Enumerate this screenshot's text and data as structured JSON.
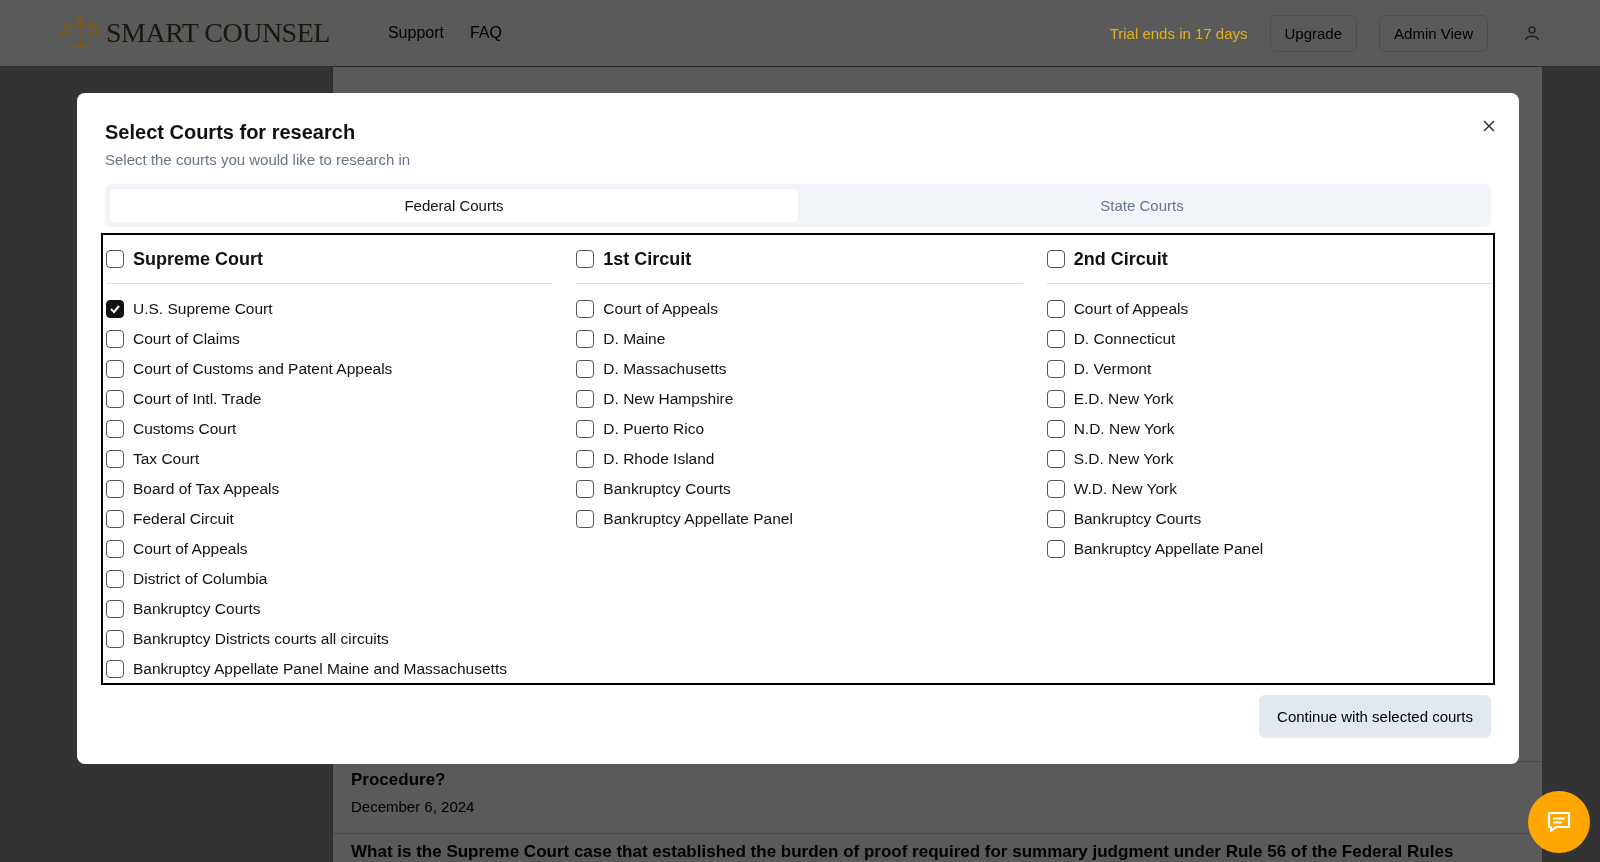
{
  "header": {
    "logo": "SMART COUNSEL",
    "nav": [
      "Support",
      "FAQ"
    ],
    "trial": "Trial ends in 17 days",
    "buttons": [
      "Upgrade",
      "Admin View"
    ]
  },
  "history": [
    {
      "title": "Procedure?",
      "date": "December 6, 2024"
    },
    {
      "title": "What is the Supreme Court case that established the burden of proof required for summary judgment under Rule 56 of the Federal Rules"
    }
  ],
  "dialog": {
    "title": "Select Courts for research",
    "subtitle": "Select the courts you would like to research in",
    "tabs": [
      {
        "label": "Federal Courts",
        "selected": true
      },
      {
        "label": "State Courts",
        "selected": false
      }
    ],
    "groups": [
      {
        "name": "Supreme Court",
        "checked": false,
        "courts": [
          {
            "name": "U.S. Supreme Court",
            "checked": true
          },
          {
            "name": "Court of Claims",
            "checked": false
          },
          {
            "name": "Court of Customs and Patent Appeals",
            "checked": false
          },
          {
            "name": "Court of Intl. Trade",
            "checked": false
          },
          {
            "name": "Customs Court",
            "checked": false
          },
          {
            "name": "Tax Court",
            "checked": false
          },
          {
            "name": "Board of Tax Appeals",
            "checked": false
          },
          {
            "name": "Federal Circuit",
            "checked": false
          },
          {
            "name": "Court of Appeals",
            "checked": false
          },
          {
            "name": "District of Columbia",
            "checked": false
          },
          {
            "name": "Bankruptcy Courts",
            "checked": false
          },
          {
            "name": "Bankruptcy Districts courts all circuits",
            "checked": false
          },
          {
            "name": "Bankruptcy Appellate Panel Maine and Massachusetts",
            "checked": false
          }
        ]
      },
      {
        "name": "1st Circuit",
        "checked": false,
        "courts": [
          {
            "name": "Court of Appeals",
            "checked": false
          },
          {
            "name": "D. Maine",
            "checked": false
          },
          {
            "name": "D. Massachusetts",
            "checked": false
          },
          {
            "name": "D. New Hampshire",
            "checked": false
          },
          {
            "name": "D. Puerto Rico",
            "checked": false
          },
          {
            "name": "D. Rhode Island",
            "checked": false
          },
          {
            "name": "Bankruptcy Courts",
            "checked": false
          },
          {
            "name": "Bankruptcy Appellate Panel",
            "checked": false
          }
        ]
      },
      {
        "name": "2nd Circuit",
        "checked": false,
        "courts": [
          {
            "name": "Court of Appeals",
            "checked": false
          },
          {
            "name": "D. Connecticut",
            "checked": false
          },
          {
            "name": "D. Vermont",
            "checked": false
          },
          {
            "name": "E.D. New York",
            "checked": false
          },
          {
            "name": "N.D. New York",
            "checked": false
          },
          {
            "name": "S.D. New York",
            "checked": false
          },
          {
            "name": "W.D. New York",
            "checked": false
          },
          {
            "name": "Bankruptcy Courts",
            "checked": false
          },
          {
            "name": "Bankruptcy Appellate Panel",
            "checked": false
          }
        ]
      }
    ],
    "button": "Continue with selected courts"
  }
}
